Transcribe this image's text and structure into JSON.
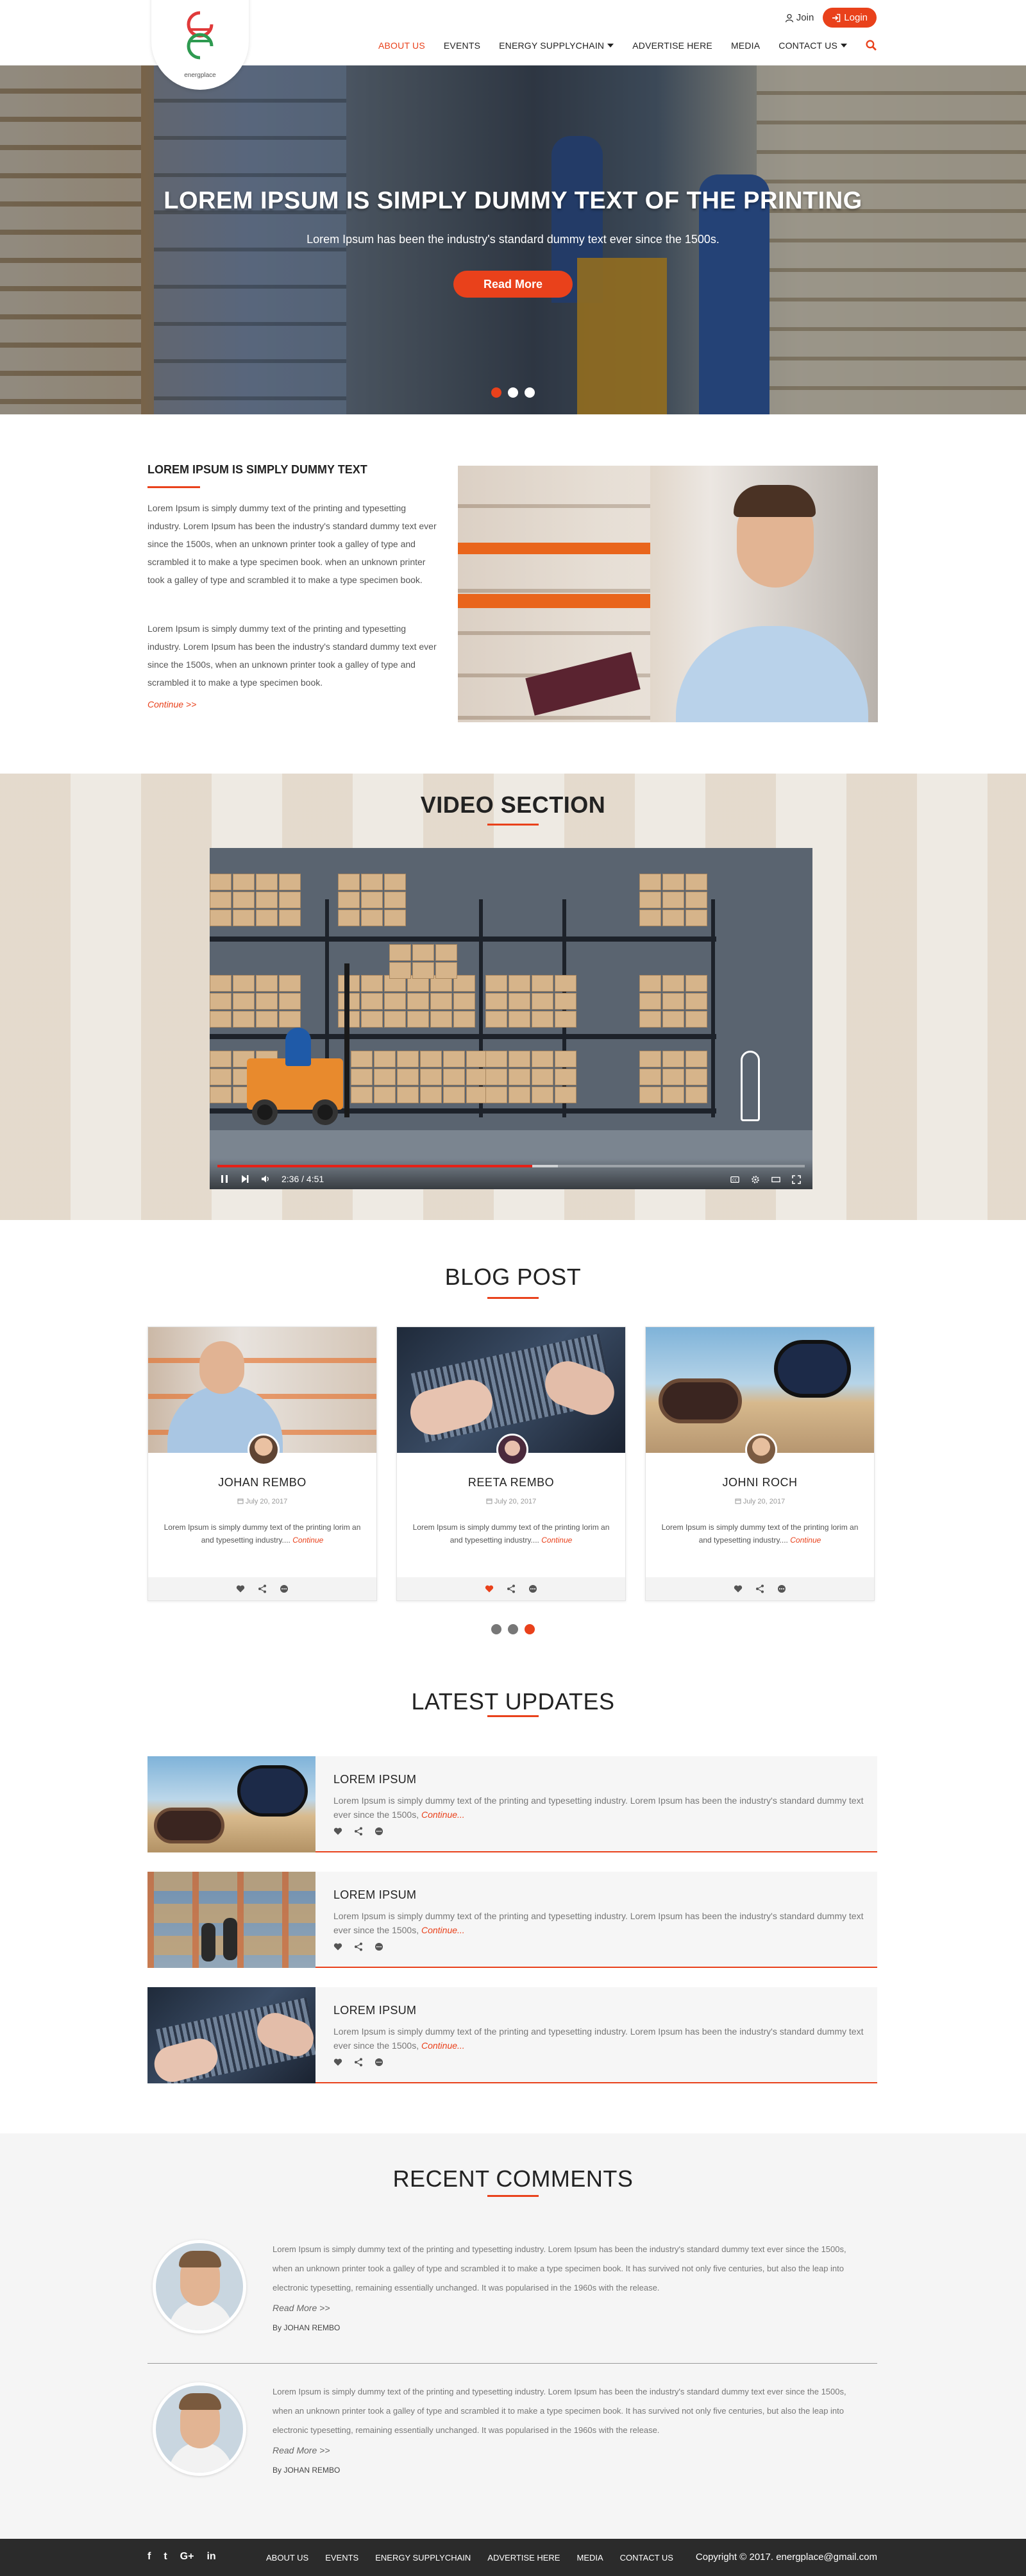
{
  "brand": {
    "logo_text": "energplace"
  },
  "header": {
    "join_label": "Join",
    "login_label": "Login",
    "nav": [
      {
        "label": "ABOUT US",
        "active": true,
        "dropdown": false
      },
      {
        "label": "EVENTS",
        "active": false,
        "dropdown": false
      },
      {
        "label": "ENERGY SUPPLYCHAIN",
        "active": false,
        "dropdown": true
      },
      {
        "label": "ADVERTISE HERE",
        "active": false,
        "dropdown": false
      },
      {
        "label": "MEDIA",
        "active": false,
        "dropdown": false
      },
      {
        "label": "CONTACT US",
        "active": false,
        "dropdown": true
      }
    ]
  },
  "hero": {
    "title": "LOREM IPSUM IS SIMPLY DUMMY TEXT OF THE PRINTING",
    "subtitle": "Lorem Ipsum has been the industry's standard dummy text ever since the 1500s.",
    "button_label": "Read More",
    "slides": 3,
    "active_slide": 0
  },
  "about": {
    "title": "LOREM IPSUM IS SIMPLY DUMMY TEXT",
    "paragraph_1": "Lorem Ipsum is simply dummy text of the printing and typesetting industry. Lorem Ipsum has been the industry's standard dummy text ever since the 1500s, when an unknown printer took a galley of type and scrambled it to make a type specimen book. when an unknown printer took a galley of type and scrambled it to make a type specimen book.",
    "paragraph_2": "Lorem Ipsum is simply dummy text of the printing and typesetting industry. Lorem Ipsum has been the industry's standard dummy text ever since the 1500s, when an unknown printer took a galley of type and scrambled it to make a type specimen book.",
    "continue_label": "Continue >>"
  },
  "video": {
    "title": "VIDEO SECTION",
    "time_current": "2:36",
    "time_total": "4:51",
    "progress": 0.536,
    "buffered": 0.58
  },
  "blog": {
    "title": "BLOG POST",
    "continue_label": "Continue",
    "posts": [
      {
        "author": "JOHAN REMBO",
        "date": "July 20, 2017",
        "excerpt": "Lorem Ipsum is simply dummy text of the printing lorim an and typesetting industry....",
        "liked": false
      },
      {
        "author": "REETA REMBO",
        "date": "July 20, 2017",
        "excerpt": "Lorem Ipsum is simply dummy text of the printing lorim an and typesetting industry....",
        "liked": true
      },
      {
        "author": "JOHNI ROCH",
        "date": "July 20, 2017",
        "excerpt": "Lorem Ipsum is simply dummy text of the printing lorim an and typesetting industry....",
        "liked": false
      }
    ],
    "pager": 3,
    "active_page": 2
  },
  "updates": {
    "title": "LATEST UPDATES",
    "continue_label": "Continue...",
    "items": [
      {
        "title": "LOREM IPSUM",
        "text": "Lorem Ipsum is simply dummy text of the printing and typesetting industry. Lorem Ipsum has been the industry's standard dummy text ever since the 1500s,"
      },
      {
        "title": "LOREM IPSUM",
        "text": "Lorem Ipsum is simply dummy text of the printing and typesetting industry. Lorem Ipsum has been the industry's standard dummy text ever since the 1500s,"
      },
      {
        "title": "LOREM IPSUM",
        "text": "Lorem Ipsum is simply dummy text of the printing and typesetting industry. Lorem Ipsum has been the industry's standard dummy text ever since the 1500s,"
      }
    ]
  },
  "comments": {
    "title": "RECENT COMMENTS",
    "items": [
      {
        "text": "Lorem Ipsum is simply dummy text of the printing and typesetting industry. Lorem Ipsum has been the industry's standard dummy text ever since the 1500s, when an unknown printer took a galley of type and scrambled it to make a type specimen book. It has survived not only five centuries, but also the leap into electronic typesetting, remaining essentially unchanged. It was popularised in the 1960s with the release.",
        "read_more": "Read More >>",
        "by": "By JOHAN REMBO"
      },
      {
        "text": "Lorem Ipsum is simply dummy text of the printing and typesetting industry. Lorem Ipsum has been the industry's standard dummy text ever since the 1500s, when an unknown printer took a galley of type and scrambled it to make a type specimen book. It has survived not only five centuries, but also the leap into electronic typesetting, remaining essentially unchanged. It was popularised in the 1960s with the release.",
        "read_more": "Read More >>",
        "by": "By JOHAN REMBO"
      }
    ]
  },
  "footer": {
    "social": [
      "f",
      "t",
      "G+",
      "in"
    ],
    "nav": [
      "ABOUT US",
      "EVENTS",
      "ENERGY SUPPLYCHAIN",
      "ADVERTISE HERE",
      "MEDIA",
      "CONTACT US"
    ],
    "copyright": "Copyright © 2017. energplace@gmail.com"
  },
  "colors": {
    "accent": "#e9411b",
    "footer_bg": "#2b2b2b",
    "text": "#333333"
  }
}
